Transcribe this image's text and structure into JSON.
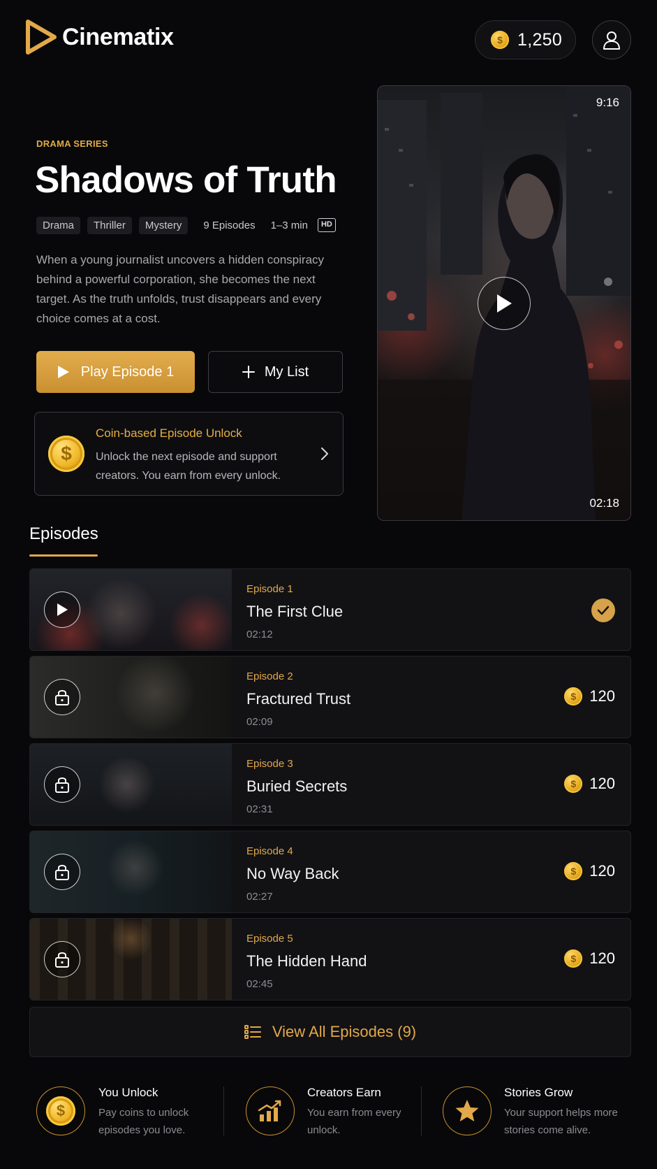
{
  "header": {
    "brand": "Cinematix",
    "coin_balance": "1,250"
  },
  "hero": {
    "series_tag": "DRAMA SERIES",
    "title": "Shadows of Truth",
    "genres": [
      "Drama",
      "Thriller",
      "Mystery"
    ],
    "episode_count": "9 Episodes",
    "duration": "1–3 min",
    "quality": "HD",
    "description": "When a young journalist uncovers a hidden conspiracy behind a powerful corporation, she becomes the next target. As the truth unfolds, trust disappears and every choice comes at a cost.",
    "play_label": "Play Episode 1",
    "mylist_label": "My List"
  },
  "unlock_card": {
    "title": "Coin-based Episode Unlock",
    "text": "Unlock the next episode and support creators. You earn from every unlock."
  },
  "video": {
    "ratio": "9:16",
    "time": "02:18"
  },
  "episodes": {
    "heading": "Episodes",
    "items": [
      {
        "number": "Episode 1",
        "title": "The First Clue",
        "duration": "02:12",
        "status": "watched",
        "price": ""
      },
      {
        "number": "Episode 2",
        "title": "Fractured Trust",
        "duration": "02:09",
        "status": "locked",
        "price": "120"
      },
      {
        "number": "Episode 3",
        "title": "Buried Secrets",
        "duration": "02:31",
        "status": "locked",
        "price": "120"
      },
      {
        "number": "Episode 4",
        "title": "No Way Back",
        "duration": "02:27",
        "status": "locked",
        "price": "120"
      },
      {
        "number": "Episode 5",
        "title": "The Hidden Hand",
        "duration": "02:45",
        "status": "locked",
        "price": "120"
      }
    ],
    "view_all_label": "View All Episodes (9)"
  },
  "features": [
    {
      "title": "You Unlock",
      "text": "Pay coins to unlock episodes you love.",
      "icon": "coin-icon"
    },
    {
      "title": "Creators Earn",
      "text": "You earn from every unlock.",
      "icon": "growth-chart-icon"
    },
    {
      "title": "Stories Grow",
      "text": "Your support helps more stories come alive.",
      "icon": "star-icon"
    }
  ],
  "colors": {
    "accent": "#e2a84a",
    "background": "#08080a",
    "card": "#121215",
    "coin": "#f0b526"
  }
}
